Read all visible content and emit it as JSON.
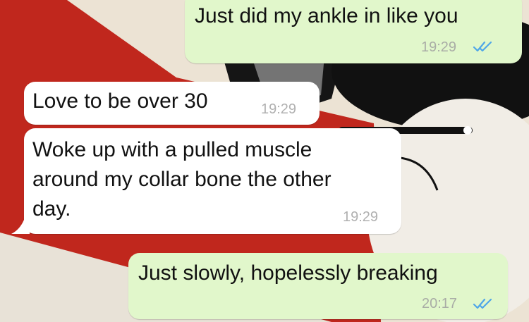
{
  "messages": [
    {
      "direction": "outgoing",
      "text": "Just did my ankle in like you",
      "time": "19:29",
      "status": "read"
    },
    {
      "direction": "incoming",
      "text": "Love to be over 30",
      "time": "19:29"
    },
    {
      "direction": "incoming",
      "text_lines": [
        "Woke up with a pulled muscle",
        "around my collar bone the other",
        "day."
      ],
      "time": "19:29"
    },
    {
      "direction": "outgoing",
      "text": "Just slowly, hopelessly breaking",
      "time": "20:17",
      "status": "read"
    }
  ],
  "colors": {
    "outgoing_bubble": "#e1f7cb",
    "incoming_bubble": "#ffffff",
    "read_ticks": "#4fa6e8"
  }
}
